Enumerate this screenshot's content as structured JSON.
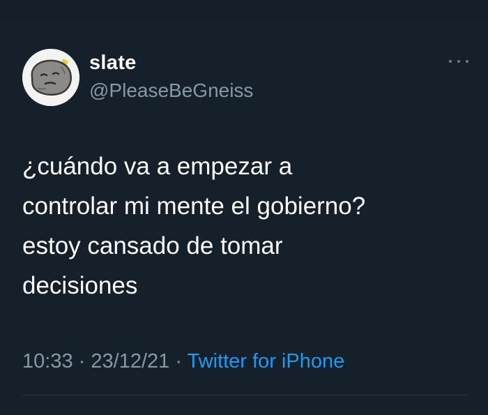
{
  "user": {
    "display_name": "slate",
    "handle": "@PleaseBeGneiss"
  },
  "tweet": {
    "text": "¿cuándo va a empezar a\ncontrolar mi mente el gobierno?\nestoy cansado de tomar\ndecisiones",
    "time": "10:33",
    "separator": "·",
    "date": "23/12/21",
    "source": "Twitter for iPhone"
  },
  "icons": {
    "avatar": "rock-avatar-icon",
    "more": "more-dots-icon"
  },
  "colors": {
    "background": "#15202b",
    "text": "#ffffff",
    "secondary_text": "#8899a6",
    "link": "#1d9bf0"
  }
}
